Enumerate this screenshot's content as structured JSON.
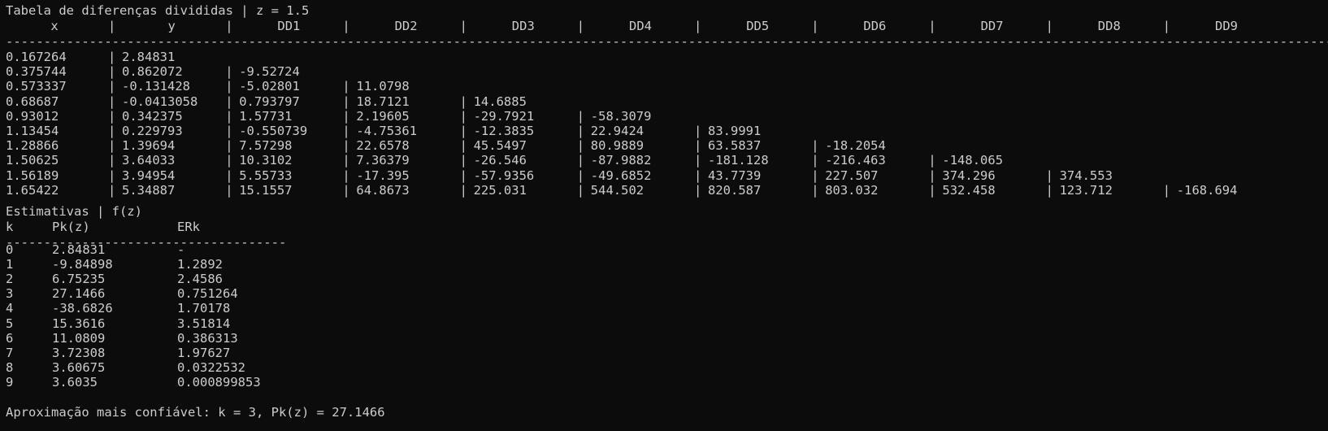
{
  "window": {
    "background": "#0c0c0c",
    "foreground": "#cccccc"
  },
  "table": {
    "title": "Tabela de diferenças divididas | z = 1.5",
    "headers": [
      "x",
      "y",
      "DD1",
      "DD2",
      "DD3",
      "DD4",
      "DD5",
      "DD6",
      "DD7",
      "DD8",
      "DD9"
    ],
    "rule": "----------------------------------------------------------------------------------------------------------------------------------------------------------------------------------------------------------",
    "rows": [
      [
        "0.167264",
        "2.84831"
      ],
      [
        "0.375744",
        "0.862072",
        "-9.52724"
      ],
      [
        "0.573337",
        "-0.131428",
        "-5.02801",
        "11.0798"
      ],
      [
        "0.68687",
        "-0.0413058",
        "0.793797",
        "18.7121",
        "14.6885"
      ],
      [
        "0.93012",
        "0.342375",
        "1.57731",
        "2.19605",
        "-29.7921",
        "-58.3079"
      ],
      [
        "1.13454",
        "0.229793",
        "-0.550739",
        "-4.75361",
        "-12.3835",
        "22.9424",
        "83.9991"
      ],
      [
        "1.28866",
        "1.39694",
        "7.57298",
        "22.6578",
        "45.5497",
        "80.9889",
        "63.5837",
        "-18.2054"
      ],
      [
        "1.50625",
        "3.64033",
        "10.3102",
        "7.36379",
        "-26.546",
        "-87.9882",
        "-181.128",
        "-216.463",
        "-148.065"
      ],
      [
        "1.56189",
        "3.94954",
        "5.55733",
        "-17.395",
        "-57.9356",
        "-49.6852",
        "43.7739",
        "227.507",
        "374.296",
        "374.553"
      ],
      [
        "1.65422",
        "5.34887",
        "15.1557",
        "64.8673",
        "225.031",
        "544.502",
        "820.587",
        "803.032",
        "532.458",
        "123.712",
        "-168.694"
      ]
    ]
  },
  "estimates": {
    "title": "Estimativas | f(z)",
    "headers": [
      "k",
      "Pk(z)",
      "ERk"
    ],
    "rule": "-------------------------------------",
    "rows": [
      [
        "0",
        "2.84831",
        "-"
      ],
      [
        "1",
        "-9.84898",
        "1.2892"
      ],
      [
        "2",
        "6.75235",
        "2.4586"
      ],
      [
        "3",
        "27.1466",
        "0.751264"
      ],
      [
        "4",
        "-38.6826",
        "1.70178"
      ],
      [
        "5",
        "15.3616",
        "3.51814"
      ],
      [
        "6",
        "11.0809",
        "0.386313"
      ],
      [
        "7",
        "3.72308",
        "1.97627"
      ],
      [
        "8",
        "3.60675",
        "0.0322532"
      ],
      [
        "9",
        "3.6035",
        "0.000899853"
      ]
    ]
  },
  "conclusion": "Aproximação mais confiável: k = 3, Pk(z) = 27.1466"
}
